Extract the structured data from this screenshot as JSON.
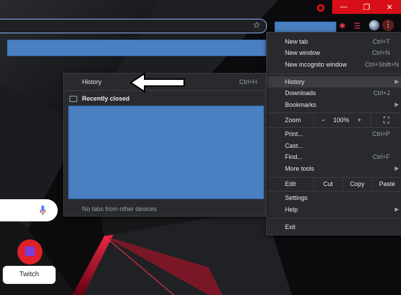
{
  "colors": {
    "accent_red": "#d80f16",
    "menu_bg": "#292a2d",
    "redaction": "#4a7fc1",
    "omnibox_border": "#8ab4f8"
  },
  "toolbar": {
    "bookmark_icon": "star-icon",
    "extension_icons": [
      "puzzle-icon",
      "media-queue-icon"
    ],
    "profile_icon": "avatar",
    "menu_icon": "kebab-menu-icon"
  },
  "main_menu": {
    "items_top": [
      {
        "label": "New tab",
        "shortcut": "Ctrl+T"
      },
      {
        "label": "New window",
        "shortcut": "Ctrl+N"
      },
      {
        "label": "New incognito window",
        "shortcut": "Ctrl+Shift+N"
      }
    ],
    "items_mid": [
      {
        "label": "History",
        "shortcut": ""
      },
      {
        "label": "Downloads",
        "shortcut": "Ctrl+J"
      },
      {
        "label": "Bookmarks",
        "shortcut": ""
      }
    ],
    "zoom": {
      "label": "Zoom",
      "minus": "−",
      "level": "100%",
      "plus": "+"
    },
    "items_tools": [
      {
        "label": "Print...",
        "shortcut": "Ctrl+P"
      },
      {
        "label": "Cast...",
        "shortcut": ""
      },
      {
        "label": "Find...",
        "shortcut": "Ctrl+F"
      },
      {
        "label": "More tools",
        "shortcut": ""
      }
    ],
    "edit": {
      "label": "Edit",
      "cut": "Cut",
      "copy": "Copy",
      "paste": "Paste"
    },
    "items_bottom": [
      {
        "label": "Settings"
      },
      {
        "label": "Help"
      }
    ],
    "exit": "Exit"
  },
  "history_submenu": {
    "history": {
      "label": "History",
      "shortcut": "Ctrl+H"
    },
    "recently_closed": "Recently closed",
    "other_devices": "No tabs from other devices"
  },
  "ntp": {
    "shortcut_label": "Twitch"
  }
}
